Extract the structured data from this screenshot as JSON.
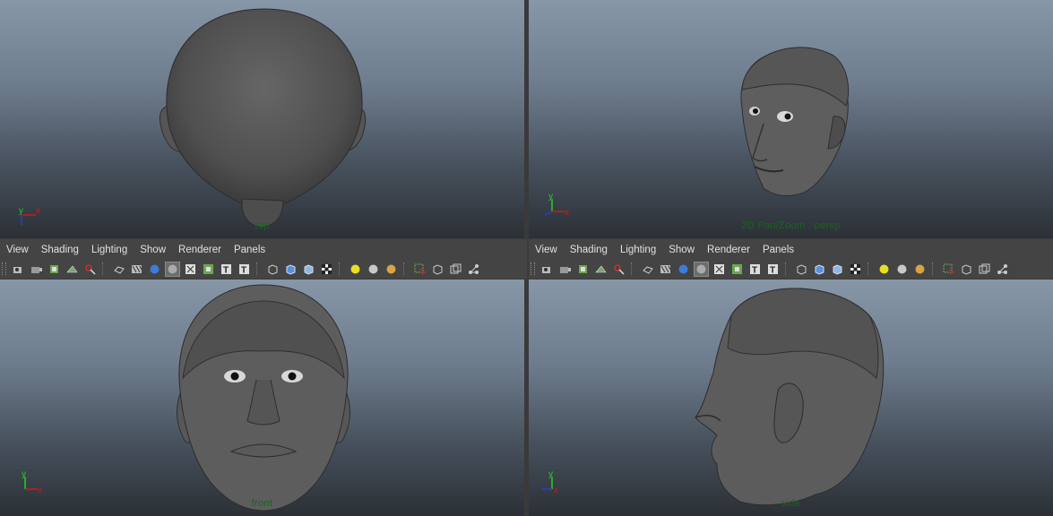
{
  "menu": [
    "View",
    "Shading",
    "Lighting",
    "Show",
    "Renderer",
    "Panels"
  ],
  "viewports": {
    "top_left": {
      "label": "top",
      "axis_x": "x",
      "axis_y": "y"
    },
    "top_right": {
      "label": "2D Pan/Zoom : persp",
      "axis_x": "x",
      "axis_y": "y"
    },
    "bottom_left": {
      "label": "front",
      "axis_x": "x",
      "axis_y": "y"
    },
    "bottom_right": {
      "label": "side",
      "axis_x": "x",
      "axis_y": "y"
    }
  },
  "toolbar_icons": [
    "camera-attributes-icon",
    "bookmark-camera-icon",
    "image-plane-icon",
    "grid-icon",
    "isolate-select-icon",
    "wireframe-icon",
    "smooth-shade-icon",
    "flat-shade-icon",
    "shade-default-material-icon",
    "xray-icon",
    "xray-joints-icon",
    "textured-icon",
    "text-icon",
    "bounding-box-icon",
    "use-default-material-icon",
    "backface-culling-icon",
    "checker-icon",
    "all-lights-icon",
    "default-light-icon",
    "shadows-icon",
    "select-camera-icon",
    "resolution-gate-icon",
    "film-gate-icon",
    "hud-icon"
  ],
  "colors": {
    "axis_x": "#d01818",
    "axis_y": "#1fd41f",
    "axis_z": "#2a39e0",
    "label_green": "#0e6b18",
    "panel_bg": "#444444"
  }
}
